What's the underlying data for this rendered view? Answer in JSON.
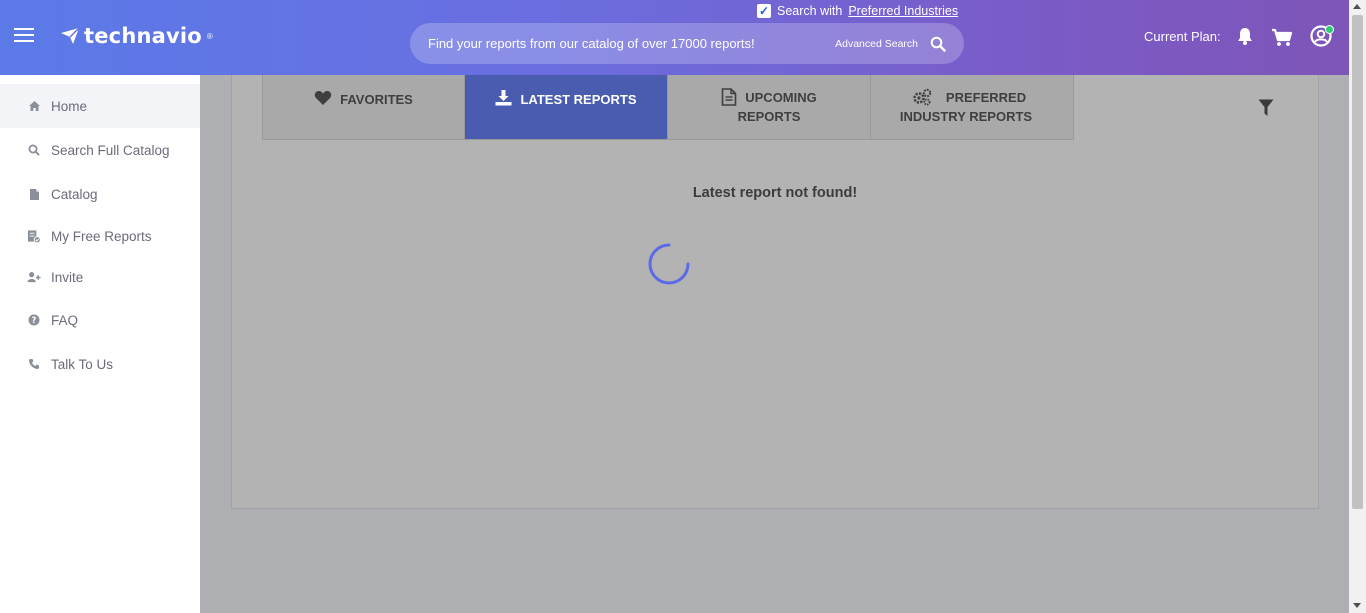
{
  "header": {
    "logo_text": "technavio",
    "logo_reg": "®",
    "preferred_prefix": "Search with",
    "preferred_link": "Preferred Industries",
    "preferred_checked": true,
    "search_placeholder": "Find your reports from our catalog of over 17000 reports!",
    "advanced_search": "Advanced Search",
    "current_plan_label": "Current Plan:"
  },
  "sidebar": {
    "items": [
      {
        "label": "Home",
        "icon": "home-icon",
        "active": true
      },
      {
        "label": "Search Full Catalog",
        "icon": "search-icon",
        "active": false
      },
      {
        "label": "Catalog",
        "icon": "document-icon",
        "active": false
      },
      {
        "label": "My Free Reports",
        "icon": "report-check-icon",
        "active": false
      },
      {
        "label": "Invite",
        "icon": "user-plus-icon",
        "active": false
      },
      {
        "label": "FAQ",
        "icon": "question-circle-icon",
        "active": false
      },
      {
        "label": "Talk To Us",
        "icon": "phone-icon",
        "active": false
      }
    ]
  },
  "tabs": [
    {
      "line1": "FAVORITES",
      "line2": "",
      "icon": "heart-icon",
      "active": false
    },
    {
      "line1": "LATEST REPORTS",
      "line2": "",
      "icon": "download-icon",
      "active": true
    },
    {
      "line1": "UPCOMING",
      "line2": "REPORTS",
      "icon": "document-icon",
      "active": false
    },
    {
      "line1": "PREFERRED",
      "line2": "INDUSTRY REPORTS",
      "icon": "gears-icon",
      "active": false
    }
  ],
  "main": {
    "message": "Latest report not found!"
  },
  "colors": {
    "header_start": "#5b7ae8",
    "header_end": "#7e55b8",
    "active_tab": "#4a5cb0",
    "spinner": "#5b6be8",
    "online": "#2ecc71"
  }
}
